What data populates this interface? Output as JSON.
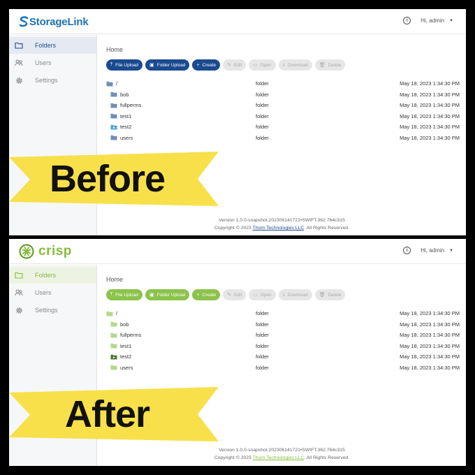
{
  "before": {
    "logo_text": "StorageLink",
    "ribbon_label": "Before",
    "accent": "#1a4a8f",
    "folder_color": "#6f8fb8",
    "highlight_folder_color": "#4aa6e0"
  },
  "after": {
    "logo_text": "crisp",
    "ribbon_label": "After",
    "accent": "#8cc34b",
    "folder_color": "#b3d98a",
    "highlight_folder_color": "#4a7a2e"
  },
  "header": {
    "user_label": "Hi, admin",
    "info_icon": "info-icon",
    "caret_icon": "chevron-down-icon"
  },
  "sidebar": {
    "items": [
      {
        "label": "Folders",
        "icon": "folder-icon"
      },
      {
        "label": "Users",
        "icon": "users-icon"
      },
      {
        "label": "Settings",
        "icon": "gear-icon"
      }
    ]
  },
  "main": {
    "breadcrumb": "Home",
    "toolbar": [
      {
        "label": "File Upload",
        "icon": "upload-icon",
        "enabled": true
      },
      {
        "label": "Folder Upload",
        "icon": "folder-upload-icon",
        "enabled": true
      },
      {
        "label": "Create",
        "icon": "plus-icon",
        "enabled": true
      },
      {
        "label": "Edit",
        "icon": "pencil-icon",
        "enabled": false
      },
      {
        "label": "Open",
        "icon": "folder-open-icon",
        "enabled": false
      },
      {
        "label": "Download",
        "icon": "download-icon",
        "enabled": false
      },
      {
        "label": "Delete",
        "icon": "trash-icon",
        "enabled": false
      }
    ],
    "rows": [
      {
        "name": "/",
        "type": "folder",
        "date": "May 18, 2023 1:34:30 PM",
        "indent": false
      },
      {
        "name": "bob",
        "type": "folder",
        "date": "May 18, 2023 1:34:30 PM",
        "indent": true
      },
      {
        "name": "fullperms",
        "type": "folder",
        "date": "May 18, 2023 1:34:30 PM",
        "indent": true
      },
      {
        "name": "test1",
        "type": "folder",
        "date": "May 18, 2023 1:34:30 PM",
        "indent": true
      },
      {
        "name": "test2",
        "type": "folder",
        "date": "May 18, 2023 1:34:30 PM",
        "indent": true
      },
      {
        "name": "users",
        "type": "folder",
        "date": "May 18, 2023 1:34:30 PM",
        "indent": true
      }
    ]
  },
  "footer": {
    "version": "Version 1.0.0-snapshot.202306141721•SWIFT.362.764c315",
    "copyright_prefix": "Copyright © 2023 ",
    "company": "Thorn Technologies LLC",
    "copyright_suffix": ". All Rights Reserved."
  },
  "ribbon_color": "#f7e04a"
}
